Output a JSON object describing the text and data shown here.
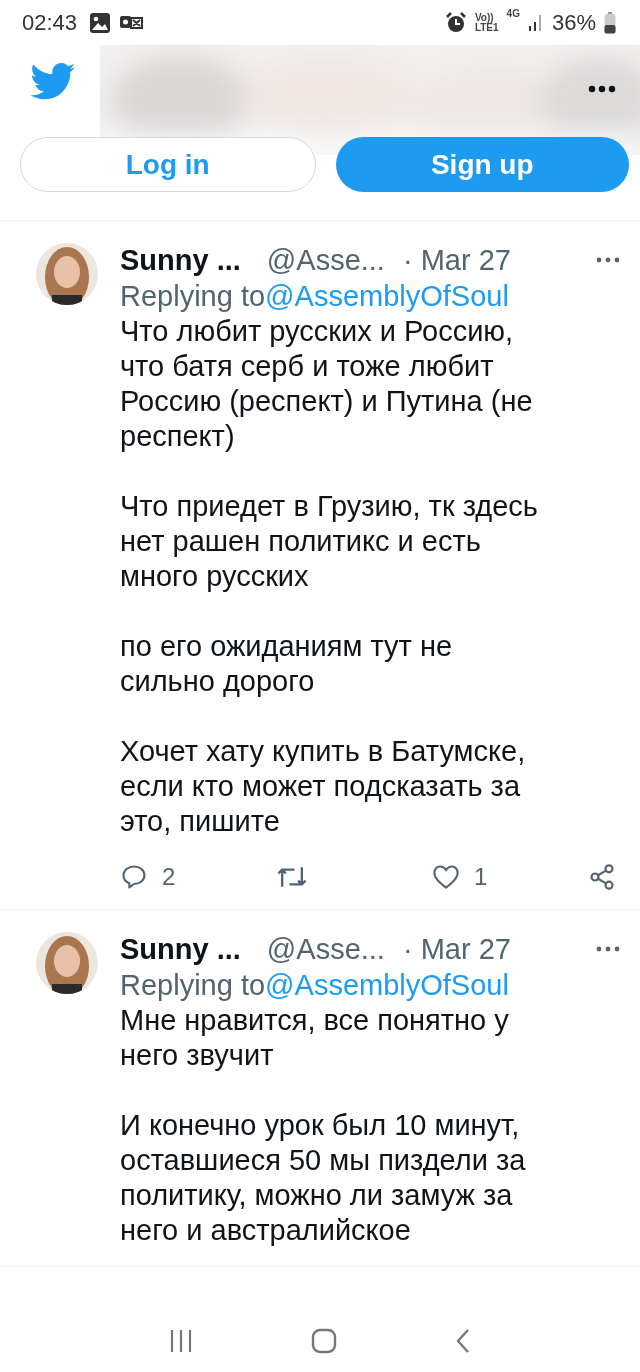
{
  "status_bar": {
    "time": "02:43",
    "volte": "Vo))",
    "lte": "LTE1",
    "network": "4G",
    "battery": "36%"
  },
  "header": {
    "login": "Log in",
    "signup": "Sign up"
  },
  "tweets": [
    {
      "name": "Sunny ...",
      "handle": "@Asse...",
      "date": "· Mar 27",
      "replying_prefix": "Replying to",
      "replying_to": "@AssemblyOfSoul",
      "paragraphs": [
        "Что любит русских и Россию,\nчто батя серб и тоже любит\nРоссию (респект) и Путина (не\nреспект)",
        "Что приедет в Грузию, тк здесь\nнет рашен политикс и есть\nмного русских",
        "по его ожиданиям тут не\nсильно дорого",
        "Хочет хату купить в Батумске,\nесли кто может подсказать за\nэто, пишите"
      ],
      "replies": "2",
      "likes": "1"
    },
    {
      "name": "Sunny ...",
      "handle": "@Asse...",
      "date": "· Mar 27",
      "replying_prefix": "Replying to",
      "replying_to": "@AssemblyOfSoul",
      "paragraphs": [
        "Мне нравится, все понятно у\nнего звучит",
        "И конечно урок был 10 минут,\nоставшиеся 50 мы пиздели за\nполитику, можно ли замуж за\nнего и австралийское"
      ]
    }
  ]
}
